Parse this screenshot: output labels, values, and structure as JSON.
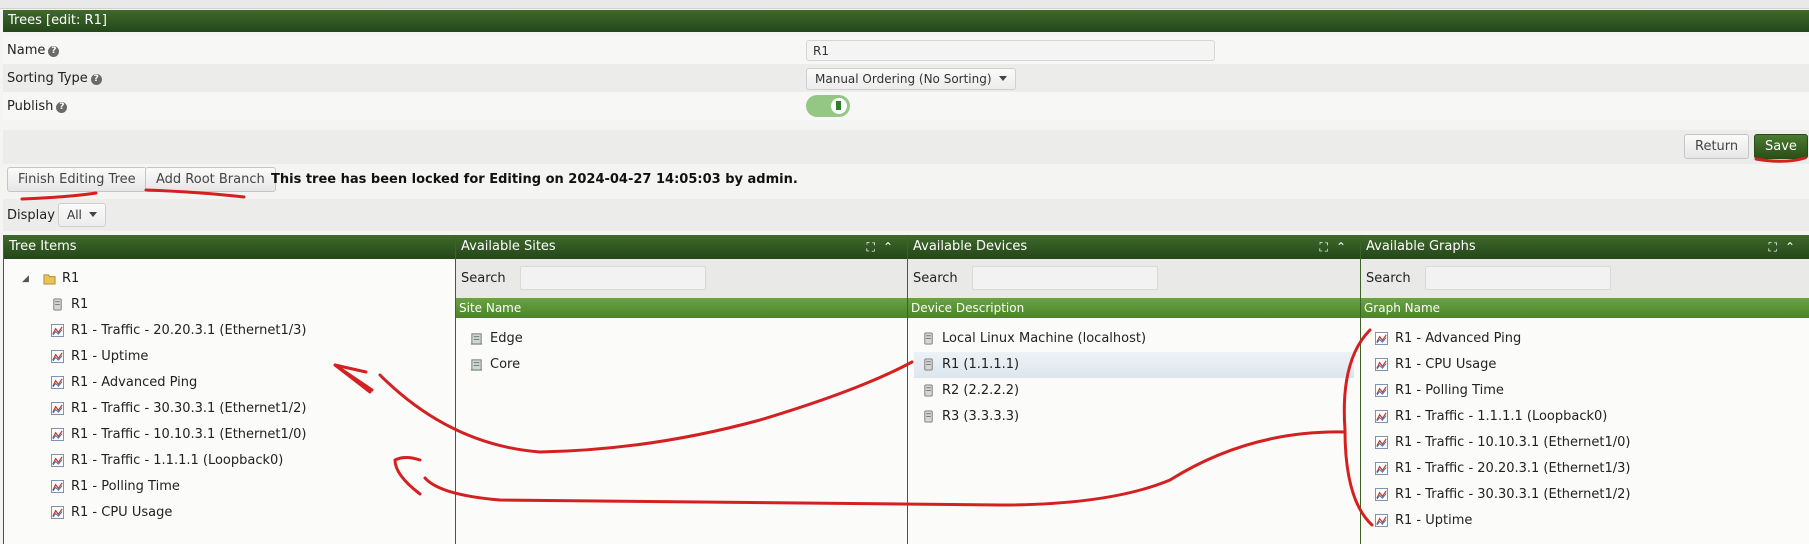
{
  "title": "Trees [edit: R1]",
  "form": {
    "name_label": "Name",
    "name_value": "R1",
    "sorting_label": "Sorting Type",
    "sorting_value": "Manual Ordering (No Sorting)",
    "publish_label": "Publish",
    "publish_on": true
  },
  "buttons": {
    "return": "Return",
    "save": "Save",
    "finish": "Finish Editing Tree",
    "add_root": "Add Root Branch"
  },
  "lock_message": "This tree has been locked for Editing on 2024-04-27 14:05:03 by admin.",
  "display": {
    "label": "Display",
    "value": "All"
  },
  "tree_panel": {
    "title": "Tree Items",
    "root": "R1",
    "items": [
      {
        "icon": "device-icon",
        "label": "R1"
      },
      {
        "icon": "graph-icon",
        "label": "R1 - Traffic - 20.20.3.1 (Ethernet1/3)"
      },
      {
        "icon": "graph-icon",
        "label": "R1 - Uptime"
      },
      {
        "icon": "graph-icon",
        "label": "R1 - Advanced Ping"
      },
      {
        "icon": "graph-icon",
        "label": "R1 - Traffic - 30.30.3.1 (Ethernet1/2)"
      },
      {
        "icon": "graph-icon",
        "label": "R1 - Traffic - 10.10.3.1 (Ethernet1/0)"
      },
      {
        "icon": "graph-icon",
        "label": "R1 - Traffic - 1.1.1.1 (Loopback0)"
      },
      {
        "icon": "graph-icon",
        "label": "R1 - Polling Time"
      },
      {
        "icon": "graph-icon",
        "label": "R1 - CPU Usage"
      }
    ]
  },
  "sites_panel": {
    "title": "Available Sites",
    "search_label": "Search",
    "column": "Site Name",
    "items": [
      "Edge",
      "Core"
    ]
  },
  "devices_panel": {
    "title": "Available Devices",
    "search_label": "Search",
    "column": "Device Description",
    "items": [
      "Local Linux Machine (localhost)",
      "R1 (1.1.1.1)",
      "R2 (2.2.2.2)",
      "R3 (3.3.3.3)"
    ],
    "selected_index": 1
  },
  "graphs_panel": {
    "title": "Available Graphs",
    "search_label": "Search",
    "column": "Graph Name",
    "items": [
      "R1 - Advanced Ping",
      "R1 - CPU Usage",
      "R1 - Polling Time",
      "R1 - Traffic - 1.1.1.1 (Loopback0)",
      "R1 - Traffic - 10.10.3.1 (Ethernet1/0)",
      "R1 - Traffic - 20.20.3.1 (Ethernet1/3)",
      "R1 - Traffic - 30.30.3.1 (Ethernet1/2)",
      "R1 - Uptime"
    ]
  },
  "colors": {
    "header_green": "#2f5a1f",
    "column_green": "#5a9636",
    "annotation_red": "#d42020"
  }
}
